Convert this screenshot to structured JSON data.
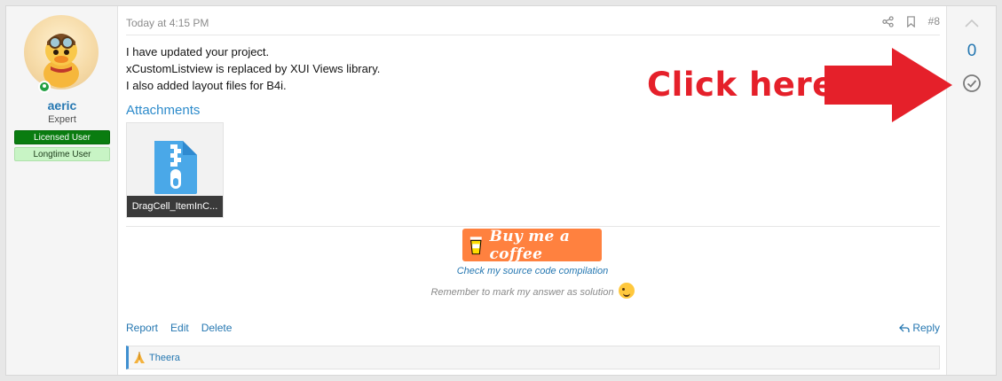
{
  "user": {
    "name": "aeric",
    "title": "Expert",
    "banners": [
      "Licensed User",
      "Longtime User"
    ]
  },
  "post": {
    "date": "Today at 4:15 PM",
    "number": "#8",
    "message_lines": [
      "I have updated your project.",
      "xCustomListview is replaced by XUI Views library.",
      "I also added layout files for B4i."
    ],
    "attachments_title": "Attachments",
    "attachment_name": "DragCell_ItemInC..."
  },
  "signature": {
    "coffee_label": "Buy me a coffee",
    "link": "Check my source code compilation",
    "note": "Remember to mark my answer as solution"
  },
  "actions": {
    "report": "Report",
    "edit": "Edit",
    "delete": "Delete",
    "reply": "Reply"
  },
  "reactions": {
    "user": "Theera"
  },
  "vote": {
    "count": "0"
  },
  "annotation": {
    "text": "Click here",
    "color": "#e5202a"
  }
}
